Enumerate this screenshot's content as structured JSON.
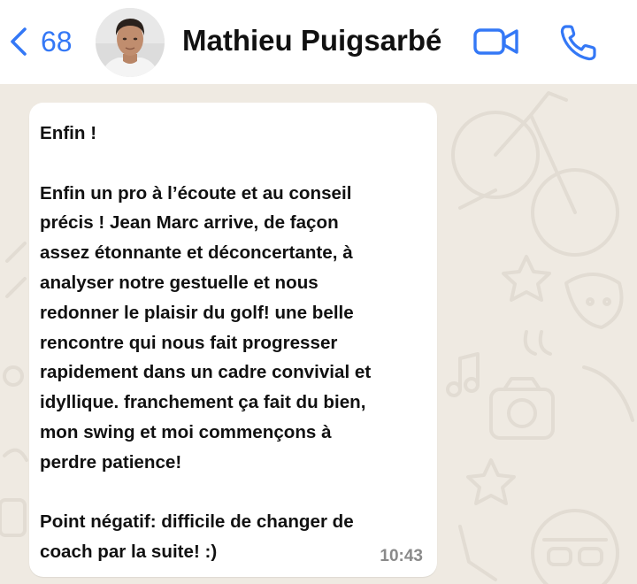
{
  "header": {
    "back_count": "68",
    "contact_name": "Mathieu Puigsarbé",
    "accent_color": "#3478f6",
    "icons": [
      "chevron-left-icon",
      "video-call-icon",
      "phone-call-icon"
    ]
  },
  "message": {
    "paragraphs": [
      "Enfin !",
      "Enfin un pro à l’écoute et au conseil\nprécis ! Jean Marc arrive, de façon\nassez étonnante et déconcertante, à\nanalyser notre gestuelle et nous\nredonner le plaisir du golf! une belle\nrencontre qui nous fait progresser\nrapidement dans un cadre convivial et\nidyllique. franchement ça fait du bien,\nmon swing et moi commençons à\nperdre patience!",
      "Point négatif: difficile de changer de\ncoach par la suite! :)"
    ],
    "time": "10:43"
  },
  "chat": {
    "background_color": "#efeae2",
    "bubble_color": "#ffffff"
  }
}
